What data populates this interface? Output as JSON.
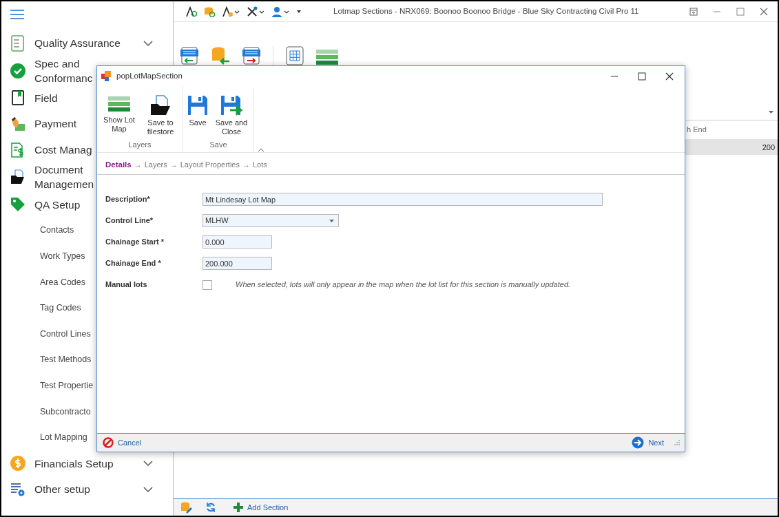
{
  "app": {
    "title": "Lotmap Sections - NRX069: Boonoo Boonoo Bridge  - Blue Sky Contracting Civil Pro 11"
  },
  "sidebar": {
    "items": [
      {
        "label": "Quality Assurance",
        "expanded": false
      },
      {
        "label": "Spec and\nConformanc"
      },
      {
        "label": "Field"
      },
      {
        "label": "Payment"
      },
      {
        "label": "Cost Manag"
      },
      {
        "label": "Document\nManagemen"
      },
      {
        "label": "QA Setup",
        "children": [
          {
            "label": "Contacts"
          },
          {
            "label": "Work Types"
          },
          {
            "label": "Area Codes"
          },
          {
            "label": "Tag Codes"
          },
          {
            "label": "Control Lines"
          },
          {
            "label": "Test Methods"
          },
          {
            "label": "Test Propertie"
          },
          {
            "label": "Subcontracto"
          },
          {
            "label": "Lot Mapping"
          }
        ]
      },
      {
        "label": "Financials Setup",
        "expanded": false
      },
      {
        "label": "Other setup",
        "expanded": false
      }
    ]
  },
  "grid": {
    "columns": [
      "h End"
    ],
    "rows": [
      {
        "cells": [
          "200"
        ],
        "selected": true
      }
    ]
  },
  "bottom_toolbar": {
    "add_label": "Add Section"
  },
  "dialog": {
    "title": "popLotMapSection",
    "ribbon": {
      "groups": [
        {
          "label": "Layers",
          "buttons": [
            "Show Lot Map",
            "Save to filestore"
          ]
        },
        {
          "label": "Save",
          "buttons": [
            "Save",
            "Save and Close"
          ]
        }
      ]
    },
    "steps": {
      "separator": "→",
      "items": [
        {
          "label": "Details",
          "selected": true
        },
        {
          "label": "Layers",
          "selected": false
        },
        {
          "label": "Layout Properties",
          "selected": false
        },
        {
          "label": "Lots",
          "selected": false
        }
      ]
    },
    "fields": [
      {
        "kind": "text",
        "label": "Description*",
        "value": "Mt Lindesay Lot Map"
      },
      {
        "kind": "select",
        "label": "Control Line*",
        "value": "MLHW"
      },
      {
        "kind": "text",
        "label": "Chainage Start *",
        "value": "0.000"
      },
      {
        "kind": "text",
        "label": "Chainage End *",
        "value": "200.000"
      },
      {
        "kind": "checkbox",
        "label": "Manual lots",
        "checked": false,
        "hint": "When selected, lots will only appear in the map when the lot list for this section is manually updated."
      }
    ],
    "footer": {
      "cancel": "Cancel",
      "next": "Next"
    }
  }
}
